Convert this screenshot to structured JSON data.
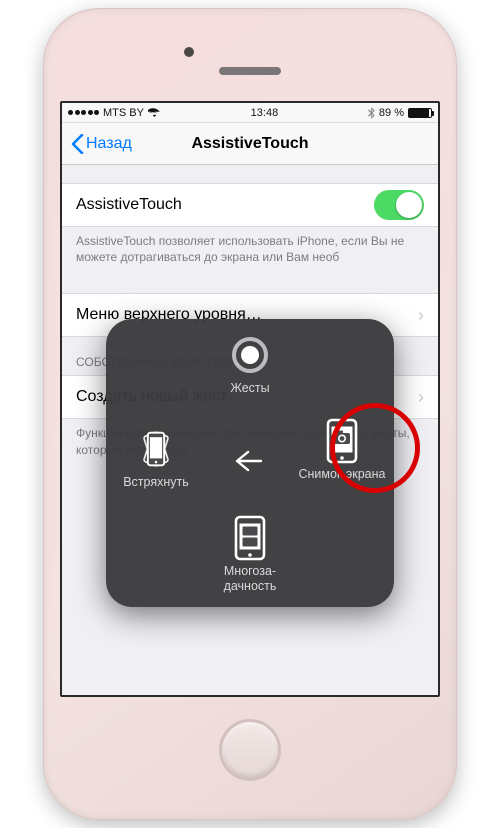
{
  "status": {
    "carrier": "MTS BY",
    "time": "13:48",
    "battery_pct": "89 %"
  },
  "nav": {
    "back_label": "Назад",
    "title": "AssistiveTouch"
  },
  "rows": {
    "toggle_label": "AssistiveTouch",
    "toggle_footer": "AssistiveTouch позволяет использовать iPhone, если Вы не можете дотрагиваться до экрана или Вам необ",
    "menu_label": "Меню верхнего уровня…",
    "actions_header": "СОБСТВЕННЫЕ ДЕЙСТВИЯ",
    "create_label": "Создать новый жест…",
    "create_footer": "Функция собственных жестов позволяет записывать жесты, которые можно выб…"
  },
  "panel": {
    "gestures": "Жесты",
    "shake": "Встряхнуть",
    "screenshot": "Снимок экрана",
    "multitask": "Многоза-\nдачность"
  }
}
